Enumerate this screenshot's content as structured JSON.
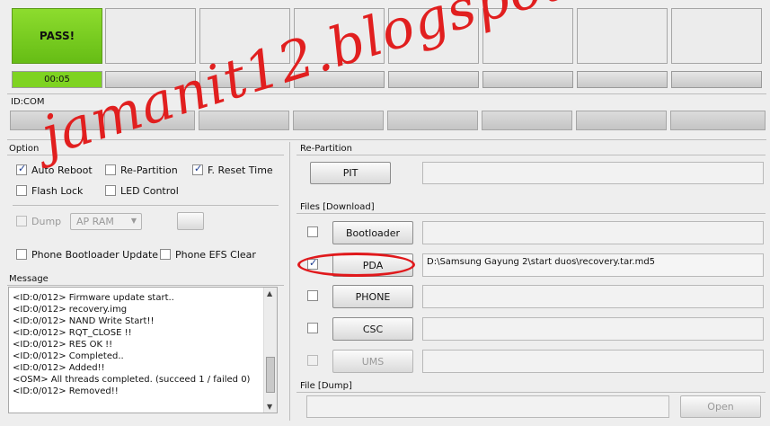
{
  "ports": {
    "pass_label": "PASS!",
    "timer": "00:05",
    "id_com_label": "ID:COM"
  },
  "option": {
    "title": "Option",
    "auto_reboot": "Auto Reboot",
    "re_partition": "Re-Partition",
    "f_reset_time": "F. Reset Time",
    "flash_lock": "Flash Lock",
    "led_control": "LED Control",
    "dump": "Dump",
    "dump_select": "AP RAM",
    "phone_bootloader_update": "Phone Bootloader Update",
    "phone_efs_clear": "Phone EFS Clear"
  },
  "message": {
    "title": "Message",
    "lines": [
      "<ID:0/012> Firmware update start..",
      "<ID:0/012> recovery.img",
      "<ID:0/012> NAND Write Start!!",
      "<ID:0/012> RQT_CLOSE !!",
      "<ID:0/012> RES OK !!",
      "<ID:0/012> Completed..",
      "<ID:0/012> Added!!",
      "<OSM> All threads completed. (succeed 1 / failed 0)",
      "<ID:0/012> Removed!!"
    ]
  },
  "repartition": {
    "title": "Re-Partition",
    "pit_button": "PIT"
  },
  "files": {
    "title": "Files [Download]",
    "bootloader": "Bootloader",
    "pda": "PDA",
    "pda_path": "D:\\Samsung Gayung 2\\start duos\\recovery.tar.md5",
    "phone": "PHONE",
    "csc": "CSC",
    "ums": "UMS"
  },
  "dumpfile": {
    "title": "File [Dump]",
    "open_button": "Open"
  },
  "watermark": "jamanit12.blogspot.com",
  "colors": {
    "pass_green": "#7ed321",
    "watermark_red": "#e11f1f"
  }
}
